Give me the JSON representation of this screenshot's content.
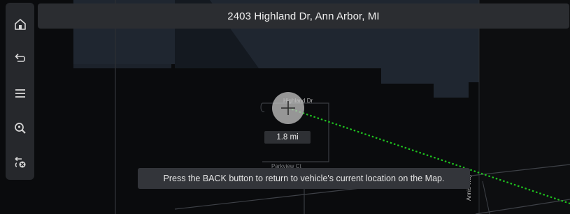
{
  "header": {
    "address": "2403 Highland Dr, Ann Arbor, MI"
  },
  "sidebar": {
    "items": [
      {
        "icon": "home-icon"
      },
      {
        "icon": "back-arrow-icon"
      },
      {
        "icon": "menu-icon"
      },
      {
        "icon": "search-location-icon"
      },
      {
        "icon": "cancel-route-icon"
      }
    ]
  },
  "map": {
    "distance_label": "1.8 mi",
    "road_labels": {
      "highland": "Highland Dr",
      "parkview": "Parkview Ct",
      "annis": "Annis Way"
    },
    "route_color": "#1fc41f"
  },
  "toast": {
    "message": "Press the BACK button to return to vehicle's current location on the Map."
  }
}
